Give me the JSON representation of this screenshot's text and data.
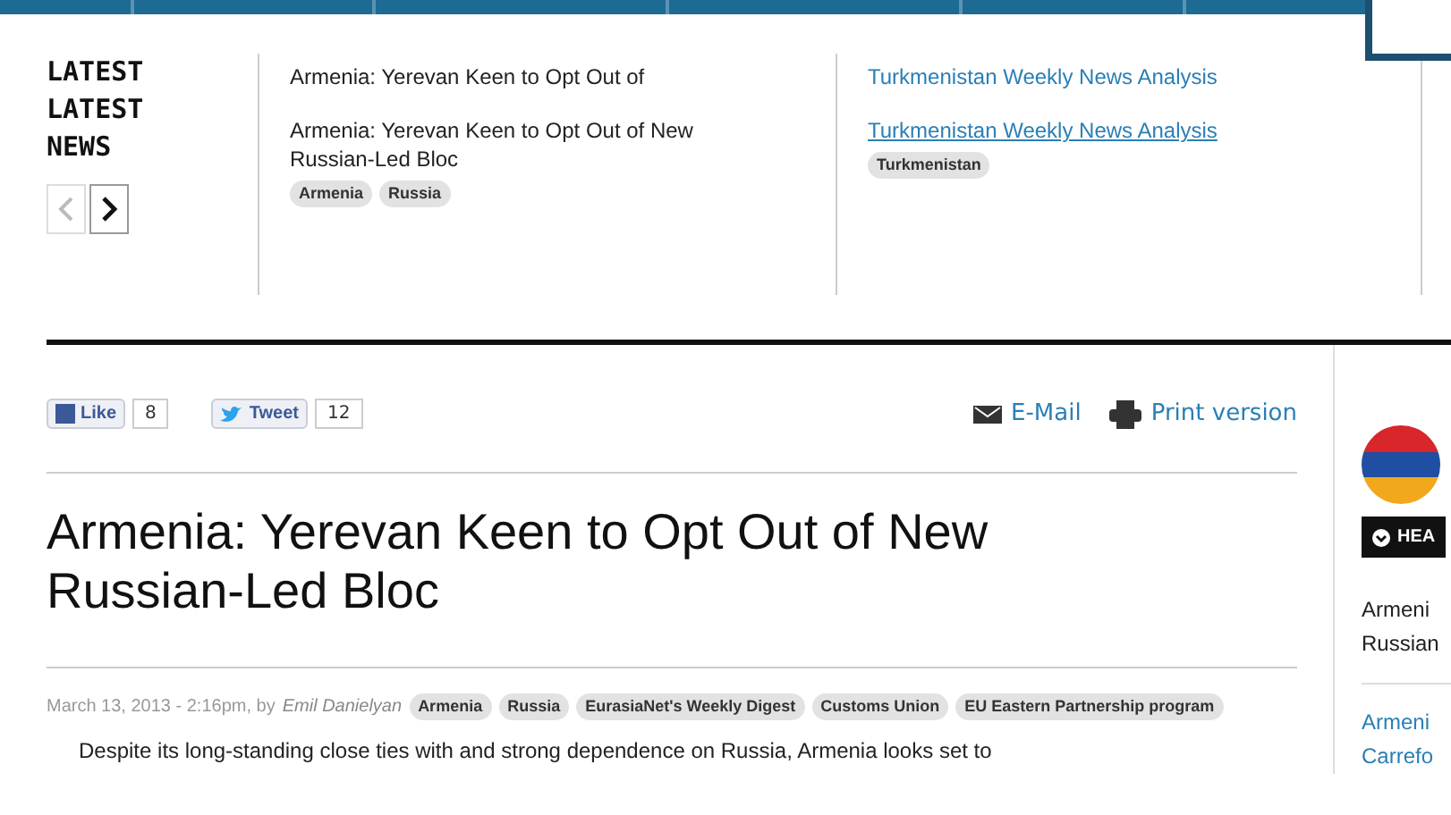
{
  "ticker": {
    "outgoing_heading": "LATEST",
    "heading": "LATEST NEWS",
    "prev_disabled": true,
    "items": [
      {
        "outgoing": "Armenia: Yerevan Keen to Opt Out of",
        "title": "Armenia: Yerevan Keen to Opt Out of New Russian-Led Bloc",
        "link": false,
        "tags": [
          "Armenia",
          "Russia"
        ]
      },
      {
        "outgoing": "Turkmenistan Weekly News Analysis",
        "title": "Turkmenistan Weekly News Analysis",
        "link": true,
        "tags": [
          "Turkmenistan"
        ]
      }
    ]
  },
  "share": {
    "like": "Like",
    "like_count": "8",
    "tweet": "Tweet",
    "tweet_count": "12",
    "email": "E-Mail",
    "print": "Print version"
  },
  "article": {
    "title": "Armenia: Yerevan Keen to Opt Out of New Russian-Led Bloc",
    "date": "March 13, 2013 - 2:16pm, by",
    "author": "Emil Danielyan",
    "tags": [
      "Armenia",
      "Russia",
      "EurasiaNet's Weekly Digest",
      "Customs Union",
      "EU Eastern Partnership program"
    ],
    "body": "Despite its long-standing close ties with and strong dependence on Russia, Armenia looks set to"
  },
  "sidebar": {
    "button": "HEA",
    "items": [
      {
        "text": "Armeni Russian",
        "link": false
      },
      {
        "text": "Armeni Carrefo",
        "link": true
      }
    ]
  }
}
